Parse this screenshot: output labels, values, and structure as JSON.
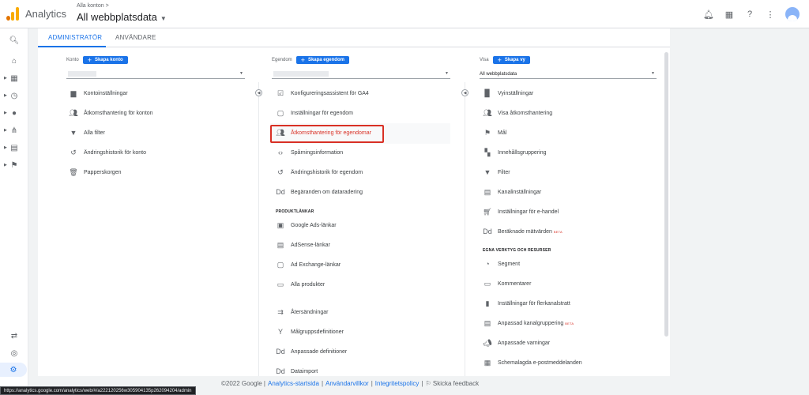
{
  "app": {
    "name": "Analytics",
    "breadcrumb": "Alla konton >",
    "account_title": "All webbplatsdata"
  },
  "tabs": [
    {
      "label": "ADMINISTRATÖR",
      "active": true
    },
    {
      "label": "ANVÄNDARE",
      "active": false
    }
  ],
  "columns": {
    "account": {
      "label": "Konto",
      "create_label": "Skapa konto",
      "items": [
        {
          "icon": "building-icon",
          "label": "Kontoinställningar"
        },
        {
          "icon": "people-icon",
          "label": "Åtkomsthantering för konton"
        },
        {
          "icon": "filter-icon",
          "label": "Alla filter"
        },
        {
          "icon": "history-icon",
          "label": "Ändringshistorik för konto"
        },
        {
          "icon": "trash-icon",
          "label": "Papperskorgen"
        }
      ]
    },
    "property": {
      "label": "Egendom",
      "create_label": "Skapa egendom",
      "items": [
        {
          "icon": "checkbox-icon",
          "label": "Konfigureringsassistent för GA4"
        },
        {
          "icon": "square-icon",
          "label": "Inställningar för egendom"
        },
        {
          "icon": "people-icon",
          "label": "Åtkomsthantering för egendomar"
        },
        {
          "icon": "code-icon",
          "label": "Spårningsinformation"
        },
        {
          "icon": "history-icon",
          "label": "Ändringshistorik för egendom"
        },
        {
          "icon": "dd-icon",
          "label": "Begäranden om dataradering"
        }
      ],
      "section_label": "PRODUKTLÄNKAR",
      "link_items": [
        {
          "icon": "google-ads-icon",
          "label": "Google Ads-länkar"
        },
        {
          "icon": "adsense-icon",
          "label": "AdSense-länkar"
        },
        {
          "icon": "ad-exchange-icon",
          "label": "Ad Exchange-länkar"
        },
        {
          "icon": "products-icon",
          "label": "Alla produkter"
        }
      ],
      "more_items": [
        {
          "icon": "postback-icon",
          "label": "Återsändningar"
        },
        {
          "icon": "audience-icon",
          "label": "Målgruppsdefinitioner"
        },
        {
          "icon": "dd-icon",
          "label": "Anpassade definitioner"
        },
        {
          "icon": "dd-icon",
          "label": "Dataimport"
        }
      ]
    },
    "view": {
      "label": "Visa",
      "create_label": "Skapa vy",
      "selected": "All webbplatsdata",
      "items": [
        {
          "icon": "document-icon",
          "label": "Vyinställningar"
        },
        {
          "icon": "people-icon",
          "label": "Visa åtkomsthantering"
        },
        {
          "icon": "flag-icon",
          "label": "Mål"
        },
        {
          "icon": "content-grouping-icon",
          "label": "Innehållsgruppering"
        },
        {
          "icon": "filter-icon",
          "label": "Filter"
        },
        {
          "icon": "channel-settings-icon",
          "label": "Kanalinställningar"
        },
        {
          "icon": "cart-icon",
          "label": "Inställningar för e-handel"
        },
        {
          "icon": "dd-icon",
          "label": "Beräknade mätvärden",
          "badge": "BETA"
        }
      ],
      "section_label": "EGNA VERKTYG OCH RESURSER",
      "tool_items": [
        {
          "icon": "segment-icon",
          "label": "Segment"
        },
        {
          "icon": "comment-icon",
          "label": "Kommentarer"
        },
        {
          "icon": "multichannel-icon",
          "label": "Inställningar för flerkanalstratt"
        },
        {
          "icon": "custom-channel-icon",
          "label": "Anpassad kanalgruppering",
          "badge": "BETA"
        },
        {
          "icon": "megaphone-icon",
          "label": "Anpassade varningar"
        },
        {
          "icon": "calendar-icon",
          "label": "Schemalagda e-postmeddelanden"
        }
      ]
    }
  },
  "footer": {
    "copyright": "©2022 Google |",
    "home": "Analytics-startsida",
    "sep1": "|",
    "terms": "Användarvillkor",
    "sep2": "|",
    "privacy": "Integritetspolicy",
    "sep3": "|",
    "feedback": "Skicka feedback"
  },
  "status_url": "https://analytics.google.com/analytics/web/#/a222120256w305904135p262094204/admin"
}
